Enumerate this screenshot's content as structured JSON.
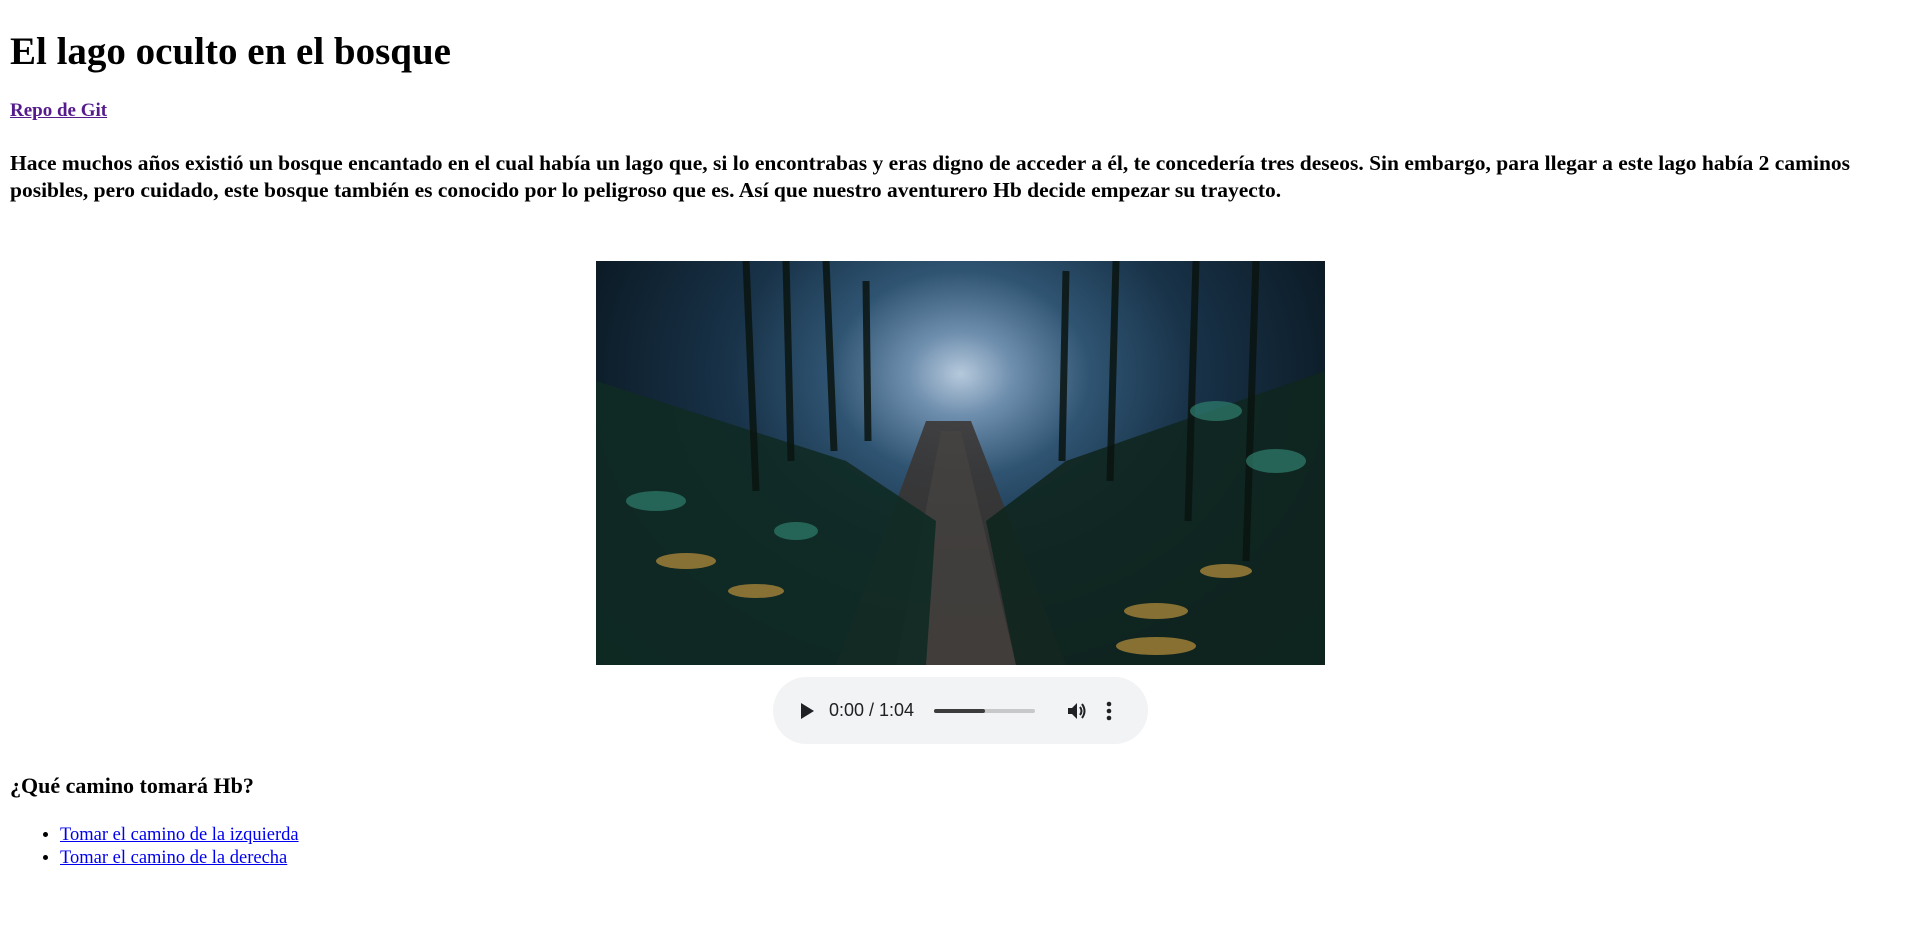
{
  "page": {
    "title": "El lago oculto en el bosque",
    "repo_link": "Repo de Git",
    "story": "Hace muchos años existió un bosque encantado en el cual había un lago que, si lo encontrabas y eras digno de acceder a él, te concedería tres deseos. Sin embargo, para llegar a este lago había 2 caminos posibles, pero cuidado, este bosque también es conocido por lo peligroso que es. Así que nuestro aventurero Hb decide empezar su trayecto.",
    "question": "¿Qué camino tomará Hb?",
    "choices": [
      "Tomar el camino de la izquierda",
      "Tomar el camino de la derecha"
    ]
  },
  "audio": {
    "time_display": "0:00 / 1:04",
    "buffered_fraction": 0.5,
    "icons": [
      "play-icon",
      "volume-icon",
      "more-vert-icon"
    ]
  },
  "colors": {
    "link": "#0000ee",
    "visited_link": "#551a8b",
    "player_bg": "#f1f3f4"
  }
}
